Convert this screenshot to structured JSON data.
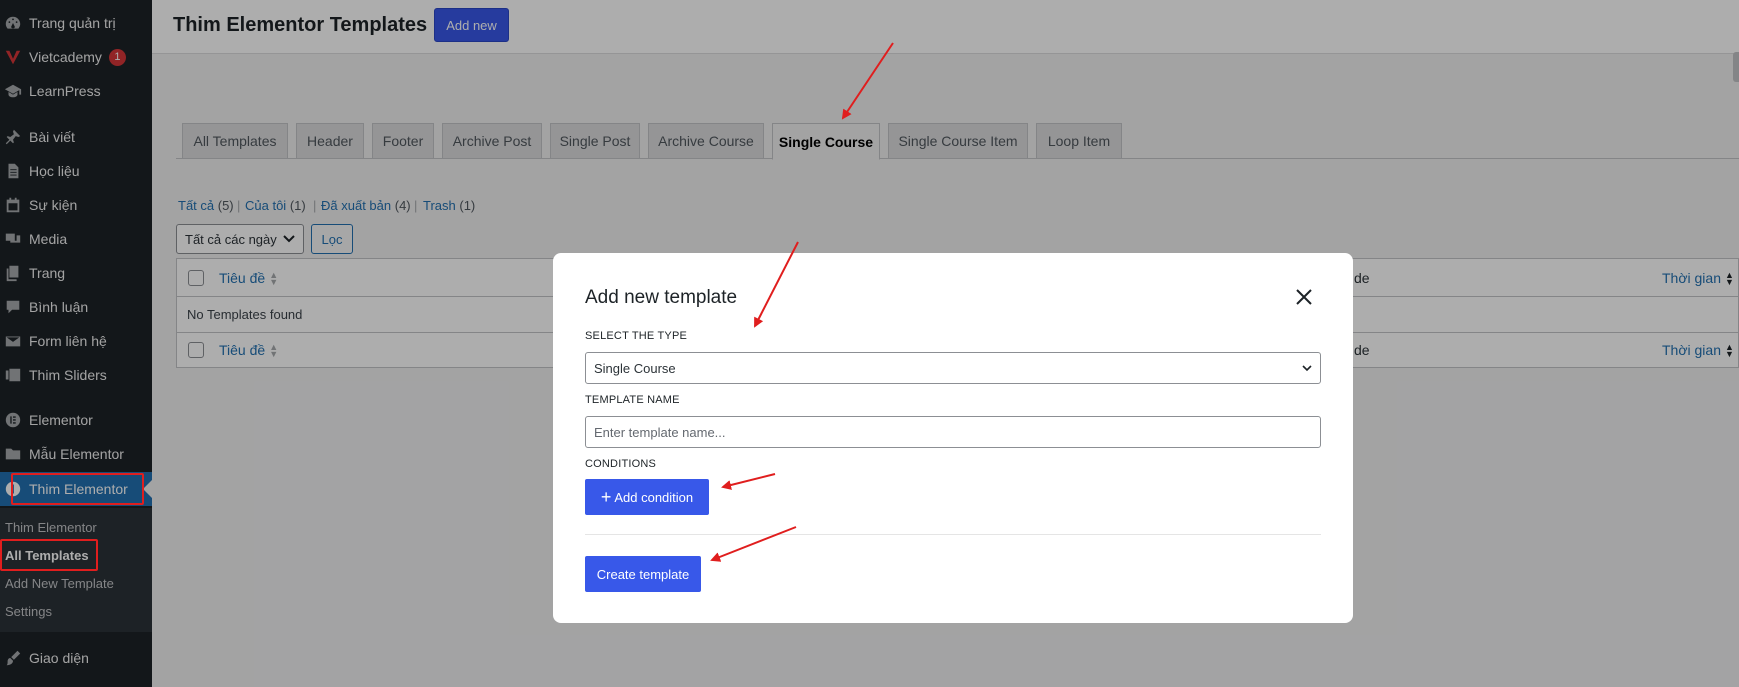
{
  "sidebar": {
    "items": [
      {
        "label": "Trang quản trị",
        "icon": "dashboard-icon"
      },
      {
        "label": "Vietcademy",
        "icon": "vietcademy-logo-icon",
        "badge": "1"
      },
      {
        "label": "LearnPress",
        "icon": "graduation-cap-icon"
      },
      {
        "label": "Bài viết",
        "icon": "pin-icon"
      },
      {
        "label": "Học liệu",
        "icon": "document-icon"
      },
      {
        "label": "Sự kiện",
        "icon": "calendar-icon"
      },
      {
        "label": "Media",
        "icon": "media-icon"
      },
      {
        "label": "Trang",
        "icon": "pages-icon"
      },
      {
        "label": "Bình luận",
        "icon": "comment-icon"
      },
      {
        "label": "Form liên hệ",
        "icon": "mail-icon"
      },
      {
        "label": "Thim Sliders",
        "icon": "slides-icon"
      },
      {
        "label": "Elementor",
        "icon": "elementor-icon"
      },
      {
        "label": "Mẫu Elementor",
        "icon": "folder-icon"
      },
      {
        "label": "Thim Elementor",
        "icon": "thim-icon",
        "current": true
      },
      {
        "label": "Giao diện",
        "icon": "paintbrush-icon"
      }
    ],
    "submenu": [
      {
        "label": "Thim Elementor"
      },
      {
        "label": "All Templates",
        "active": true
      },
      {
        "label": "Add New Template"
      },
      {
        "label": "Settings"
      }
    ]
  },
  "header": {
    "title": "Thim Elementor Templates",
    "add_new_label": "Add new"
  },
  "tabs": [
    {
      "label": "All Templates"
    },
    {
      "label": "Header"
    },
    {
      "label": "Footer"
    },
    {
      "label": "Archive Post"
    },
    {
      "label": "Single Post"
    },
    {
      "label": "Archive Course"
    },
    {
      "label": "Single Course",
      "active": true
    },
    {
      "label": "Single Course Item"
    },
    {
      "label": "Loop Item"
    }
  ],
  "filters": [
    {
      "label": "Tất cả",
      "count": "(5)"
    },
    {
      "label": "Của tôi",
      "count": "(1)"
    },
    {
      "label": "Đã xuất bản",
      "count": "(4)"
    },
    {
      "label": "Trash",
      "count": "(1)"
    }
  ],
  "filter_separator": "|",
  "toolbar": {
    "date_filter": "Tất cả các ngày",
    "filter_button": "Lọc"
  },
  "table": {
    "col_title": "Tiêu đề",
    "col_type_partial": "de",
    "col_time": "Thời gian",
    "empty_message": "No Templates found"
  },
  "modal": {
    "title": "Add new template",
    "type_label": "SELECT THE TYPE",
    "type_value": "Single Course",
    "name_label": "TEMPLATE NAME",
    "name_placeholder": "Enter template name...",
    "conditions_label": "CONDITIONS",
    "add_condition_label": "Add condition",
    "create_label": "Create template"
  },
  "colors": {
    "sidebar_bg": "#1d2327",
    "accent": "#3858e9",
    "wp_blue": "#2271b1",
    "annotation_red": "#e01e1e"
  }
}
